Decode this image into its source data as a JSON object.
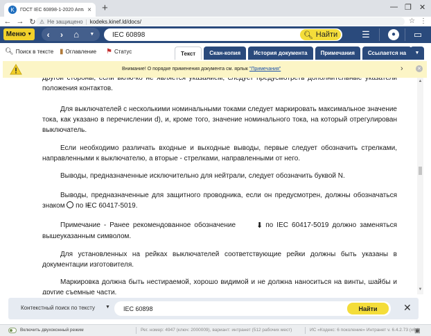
{
  "browser": {
    "tab_title": "ГОСТ IEC 60898-1-2020 Аппаратура",
    "tab_close": "×",
    "new_tab": "+",
    "secure_label": "Не защищено",
    "url": "kodeks.kinef.ld/docs/"
  },
  "app_header": {
    "menu_label": "Меню",
    "search_value": "IEC 60898",
    "find_label": "Найти"
  },
  "toolbar": {
    "search_in_text": "Поиск в тексте",
    "contents": "Оглавление",
    "status": "Статус",
    "tabs": [
      "Текст",
      "Скан-копия",
      "История документа",
      "Примечания",
      "Ссылается на"
    ]
  },
  "warning": {
    "prefix": "Внимание! О порядке применения документа см. ярлык ",
    "link": "\"Примечания\""
  },
  "document": {
    "paragraphs": [
      "другой стороны, если вклю-ко не является указанием, следует предусмотреть дополнительные указатели положения контактов.",
      "Для выключателей с несколькими номинальными токами следует маркировать максимальное значение тока, как указано в перечислении d), и, кроме того, значение номинального тока, на который отрегулирован выключатель.",
      "Если необходимо различать входные и выходные выводы, первые следует обозначить стрелками, направленными к выключателю, а вторые - стрелками, направленными от него.",
      "Выводы, предназначенные исключительно для нейтрали, следует обозначить буквой N.",
      "Для установленных на рейках выключателей соответствующие рейки должны быть указаны в документации изготовителя.",
      "Маркировка должна быть нестираемой, хорошо видимой и не должна наноситься на винты, шайбы и другие съемные части."
    ],
    "pe_para_before": "Выводы, предназначенные для защитного проводника, если он предусмотрен, должны обозначаться знаком",
    "pe_para_after": "по IEC 60417-5019.",
    "note_before": "Примечание - Ранее рекомендованное обозначение",
    "note_after": "по IEC 60417-5019 должно заменяться вышеуказанным символом."
  },
  "context_search": {
    "label": "Контекстный поиск по тексту",
    "value": "IEC 60898",
    "find_label": "Найти"
  },
  "statusbar": {
    "dual_window": "Включить двухоконный режим",
    "reg": "Рег. номер: 4947 (ключ: 2000009), вариант: интранет (512 рабочих мест)",
    "version": "ИС «Кодекс: 6 поколение» Интранет v. 6.4.2.73 (x64)"
  },
  "colors": {
    "header_blue": "#2a4a7c",
    "accent_yellow": "#f4dd3a",
    "warning_bg": "#fcf5c6"
  }
}
